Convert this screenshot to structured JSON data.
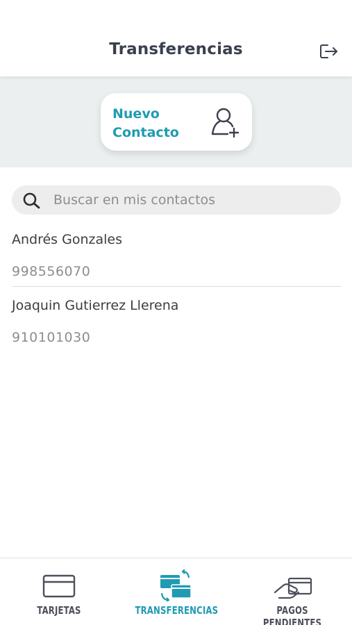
{
  "header": {
    "title": "Transferencias",
    "logout_icon": "logout-icon"
  },
  "new_contact": {
    "label_line1": "Nuevo",
    "label_line2": "Contacto",
    "icon": "add-user-icon"
  },
  "search": {
    "placeholder": "Buscar en mis contactos",
    "value": "",
    "icon": "search-icon"
  },
  "contacts": [
    {
      "name": "Andrés Gonzales",
      "phone": "998556070"
    },
    {
      "name": "Joaquin Gutierrez Llerena",
      "phone": "910101030"
    }
  ],
  "tabs": [
    {
      "label": "TARJETAS",
      "icon": "card-icon",
      "active": false
    },
    {
      "label": "TRANSFERENCIAS",
      "icon": "transfer-cards-icon",
      "active": true
    },
    {
      "label": "PAGOS PENDIENTES",
      "icon": "hand-card-icon",
      "active": false
    }
  ],
  "colors": {
    "accent": "#1f9bb3",
    "text_dark": "#3b3f4e",
    "text_muted": "#8d8d8d",
    "banner_bg": "#eceff0"
  }
}
